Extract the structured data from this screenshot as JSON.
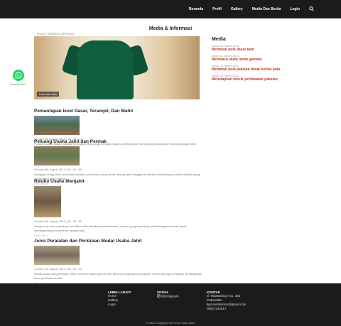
{
  "nav": {
    "items": [
      "Beranda",
      "Profil",
      "Gallery",
      "Media Dan Berita",
      "Login"
    ],
    "search_icon": "search-icon"
  },
  "whatsapp": {
    "icon": "whatsapp-icon",
    "label": "Hubungi Kami",
    "color": "#25d366"
  },
  "page": {
    "title": "Media & Informasi",
    "breadcrumb": "Home / Media & Informasi",
    "hero_caption": "Kain kain kain"
  },
  "sidebar": {
    "title": "Media",
    "items": [
      {
        "date": "Senin, 01 Maret 2021",
        "title": "Membuat pola dasar kain"
      },
      {
        "date": "Senin, 01 Maret 2021",
        "title": "Membaca skala mode gambar"
      },
      {
        "date": "Senin, 01 Maret 2021",
        "title": "Membuat pola pakaian dasar kertas pola"
      },
      {
        "date": "Senin, 01 Maret 2021",
        "title": "Menetapkan teknik pembuatan pakaian"
      }
    ]
  },
  "articles": [
    {
      "title": "Pemantapan level Dasar, Terampil, Dan Mahir",
      "date": "Sunday 8th August 2021 | 07 : 09 : 23",
      "excerpt": "Pakaian sudah bukan sekedar kebutuhan tetapi juga sebagai bagian penting untuk menunjang penampilan seseorang agar lebih percaya diri dan terlihat lebih ...",
      "read_more": "Read More"
    },
    {
      "title": "Peluang Usaha Jahit dan Permak",
      "date": "Sunday 8th August 2021 | 08 : 08 : 59",
      "excerpt": "Sebagian orang lebih menyukai pakaian customized yang dibuat oleh penjahit langganan mereka ketimbang membeli pakaian yang sudah jadi karena bentuk ...",
      "read_more": "Read More"
    },
    {
      "title": "Resiko Usaha Menjahit",
      "date": "Sunday 8th August 2021 | 08 : 08 : 59",
      "excerpt": "Setiap jenis usaha pastinya memiliki resiko dibaliknya keberhasilan, namun yang terpenting adalah bagaimana kita dapat menanganinya hal tersebut dengan baik ...",
      "read_more": "Read More"
    },
    {
      "title": "Jenis Peralatan dan Perkiraan Modal Usaha Jahit",
      "date": "Sunday 8th August 2021 | 08 : 08 : 53",
      "excerpt": "Modal usaha yang tertuang untuk memulai usaha jahit ini bisa berbeda tergantung bangunan modal dan juga peralatan bersangkutan serta perkiraan modal ...",
      "read_more": "Read More"
    }
  ],
  "footer": {
    "col1": {
      "heading": "LEBIH LANJUT",
      "links": [
        "Home",
        "Gallery",
        "Login"
      ]
    },
    "col2": {
      "heading": "SOSIAL",
      "instagram": "@instagram"
    },
    "col3": {
      "heading": "KONTAK",
      "lines": [
        "Jl. Rajawaling I No. 343",
        "P.Mandalin",
        "lkpzoorstenzen@gmail.com",
        "08527344617"
      ]
    },
    "copyright": "© 2021 Copyright LKP Zorz Zorz Junio"
  }
}
